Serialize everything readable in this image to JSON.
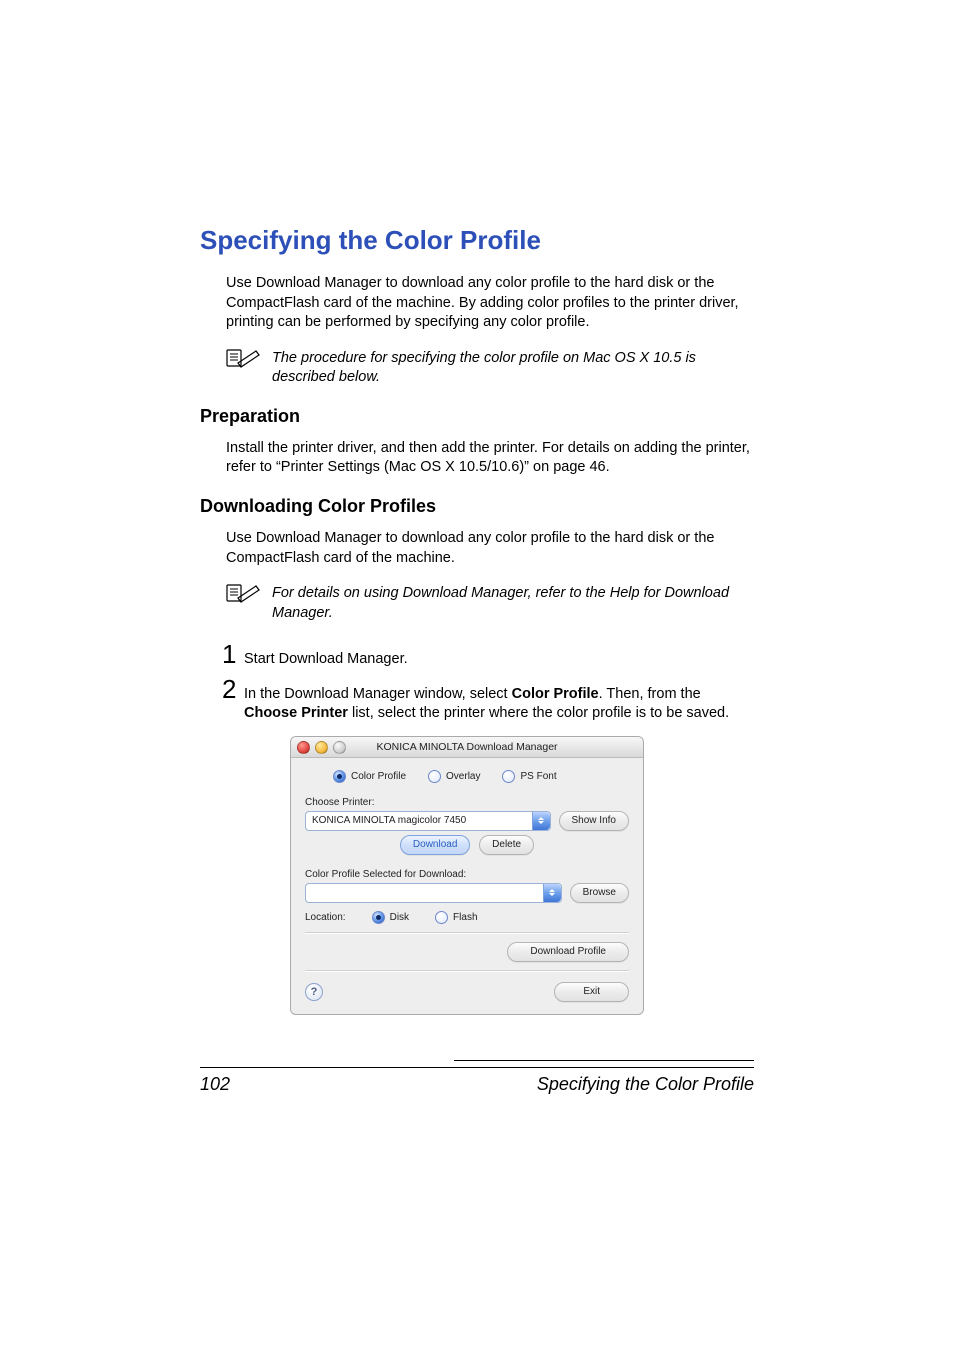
{
  "title": "Specifying the Color Profile",
  "intro": "Use Download Manager to download any color profile to the hard disk or the CompactFlash card of the machine. By adding color profiles to the printer driver, printing can be performed by specifying any color profile.",
  "note1": "The procedure for specifying the color profile on Mac OS X 10.5 is described below.",
  "preparation": {
    "heading": "Preparation",
    "text": "Install the printer driver, and then add the printer. For details on adding the printer, refer to “Printer Settings (Mac OS X 10.5/10.6)” on page 46."
  },
  "downloading": {
    "heading": "Downloading Color Profiles",
    "intro": "Use Download Manager to download any color profile to the hard disk or the CompactFlash card of the machine.",
    "note": "For details on using Download Manager, refer to the Help for Download Manager.",
    "steps": {
      "s1": {
        "num": "1",
        "text": "Start Download Manager."
      },
      "s2": {
        "num": "2",
        "pre": "In the Download Manager window, select ",
        "bold1": "Color Profile",
        "mid": ". Then, from the ",
        "bold2": "Choose Printer",
        "post": " list, select the printer where the color profile is to be saved."
      }
    }
  },
  "mac": {
    "title": "KONICA MINOLTA Download Manager",
    "radios": {
      "color_profile": "Color Profile",
      "overlay": "Overlay",
      "ps_font": "PS Font"
    },
    "choose_printer_label": "Choose Printer:",
    "printer_value": "KONICA MINOLTA magicolor 7450",
    "show_info": "Show Info",
    "download": "Download",
    "delete": "Delete",
    "profile_label": "Color Profile Selected for Download:",
    "browse": "Browse",
    "location_label": "Location:",
    "disk": "Disk",
    "flash": "Flash",
    "download_profile": "Download Profile",
    "exit": "Exit",
    "help": "?"
  },
  "footer": {
    "page_num": "102",
    "section": "Specifying the Color Profile"
  }
}
